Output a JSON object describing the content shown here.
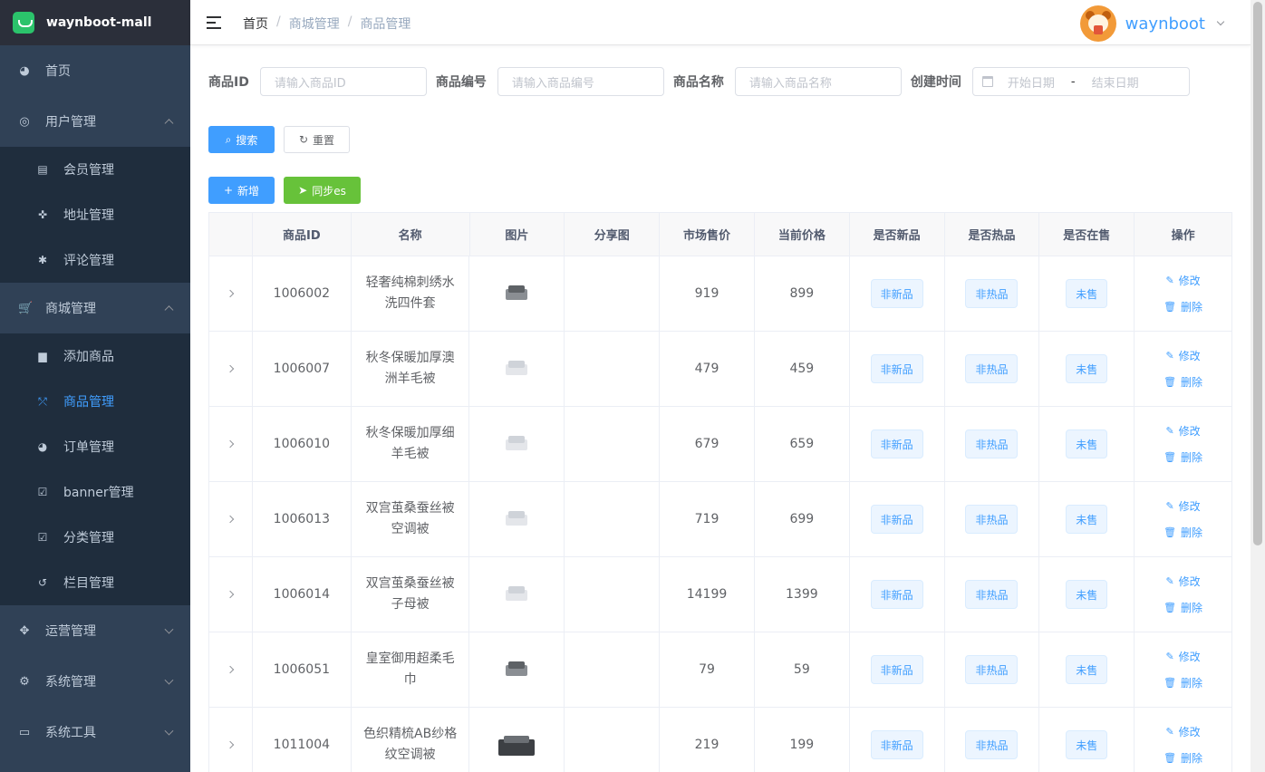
{
  "app": {
    "title": "waynboot-mall"
  },
  "sidebar": {
    "items": [
      {
        "label": "首页",
        "icon": "dashboard-icon",
        "glyph": "◕"
      },
      {
        "label": "用户管理",
        "icon": "user-group-icon",
        "glyph": "◎",
        "expanded": true,
        "children": [
          {
            "label": "会员管理",
            "icon": "member-icon",
            "glyph": "▤"
          },
          {
            "label": "地址管理",
            "icon": "address-icon",
            "glyph": "✜"
          },
          {
            "label": "评论管理",
            "icon": "bug-icon",
            "glyph": "✱"
          }
        ]
      },
      {
        "label": "商城管理",
        "icon": "cart-icon",
        "glyph": "🛒",
        "expanded": true,
        "children": [
          {
            "label": "添加商品",
            "icon": "clipboard-icon",
            "glyph": "▆"
          },
          {
            "label": "商品管理",
            "icon": "fullscreen-icon",
            "glyph": "⤱",
            "active": true
          },
          {
            "label": "订单管理",
            "icon": "dashboard-icon",
            "glyph": "◕"
          },
          {
            "label": "banner管理",
            "icon": "checkbox-icon",
            "glyph": "☑"
          },
          {
            "label": "分类管理",
            "icon": "checkbox-icon",
            "glyph": "☑"
          },
          {
            "label": "栏目管理",
            "icon": "history-icon",
            "glyph": "↺"
          }
        ]
      },
      {
        "label": "运营管理",
        "icon": "move-icon",
        "glyph": "✥",
        "expanded": false
      },
      {
        "label": "系统管理",
        "icon": "gear-icon",
        "glyph": "⚙",
        "expanded": false
      },
      {
        "label": "系统工具",
        "icon": "toolbox-icon",
        "glyph": "▭",
        "expanded": false
      }
    ]
  },
  "navbar": {
    "breadcrumb": [
      "首页",
      "商城管理",
      "商品管理"
    ],
    "username": "waynboot"
  },
  "search": {
    "goods_id_label": "商品ID",
    "goods_id_placeholder": "请输入商品ID",
    "goods_sn_label": "商品编号",
    "goods_sn_placeholder": "请输入商品编号",
    "goods_name_label": "商品名称",
    "goods_name_placeholder": "请输入商品名称",
    "create_time_label": "创建时间",
    "start_date_placeholder": "开始日期",
    "date_sep": "-",
    "end_date_placeholder": "结束日期",
    "search_button": "搜索",
    "reset_button": "重置"
  },
  "toolbar": {
    "add_button": "新增",
    "sync_button": "同步es"
  },
  "table": {
    "headers": [
      "",
      "商品ID",
      "名称",
      "图片",
      "分享图",
      "市场售价",
      "当前价格",
      "是否新品",
      "是否热品",
      "是否在售",
      "操作"
    ],
    "rows": [
      {
        "id": "1006002",
        "name": "轻奢纯棉刺绣水洗四件套",
        "thumb": "dark",
        "market_price": "919",
        "price": "899",
        "is_new": "非新品",
        "is_hot": "非热品",
        "on_sale": "未售"
      },
      {
        "id": "1006007",
        "name": "秋冬保暖加厚澳洲羊毛被",
        "thumb": "light",
        "market_price": "479",
        "price": "459",
        "is_new": "非新品",
        "is_hot": "非热品",
        "on_sale": "未售"
      },
      {
        "id": "1006010",
        "name": "秋冬保暖加厚细羊毛被",
        "thumb": "light",
        "market_price": "679",
        "price": "659",
        "is_new": "非新品",
        "is_hot": "非热品",
        "on_sale": "未售"
      },
      {
        "id": "1006013",
        "name": "双宫茧桑蚕丝被空调被",
        "thumb": "light",
        "market_price": "719",
        "price": "699",
        "is_new": "非新品",
        "is_hot": "非热品",
        "on_sale": "未售"
      },
      {
        "id": "1006014",
        "name": "双宫茧桑蚕丝被子母被",
        "thumb": "light",
        "market_price": "14199",
        "price": "1399",
        "is_new": "非新品",
        "is_hot": "非热品",
        "on_sale": "未售"
      },
      {
        "id": "1006051",
        "name": "皇室御用超柔毛巾",
        "thumb": "dark",
        "market_price": "79",
        "price": "59",
        "is_new": "非新品",
        "is_hot": "非热品",
        "on_sale": "未售"
      },
      {
        "id": "1011004",
        "name": "色织精梳AB纱格纹空调被",
        "thumb": "big",
        "market_price": "219",
        "price": "199",
        "is_new": "非新品",
        "is_hot": "非热品",
        "on_sale": "未售"
      }
    ],
    "edit_label": "修改",
    "delete_label": "删除"
  },
  "colors": {
    "sidebar_bg": "#304156",
    "submenu_bg": "#1f2d3d",
    "primary": "#409eff",
    "success": "#67c23a"
  }
}
